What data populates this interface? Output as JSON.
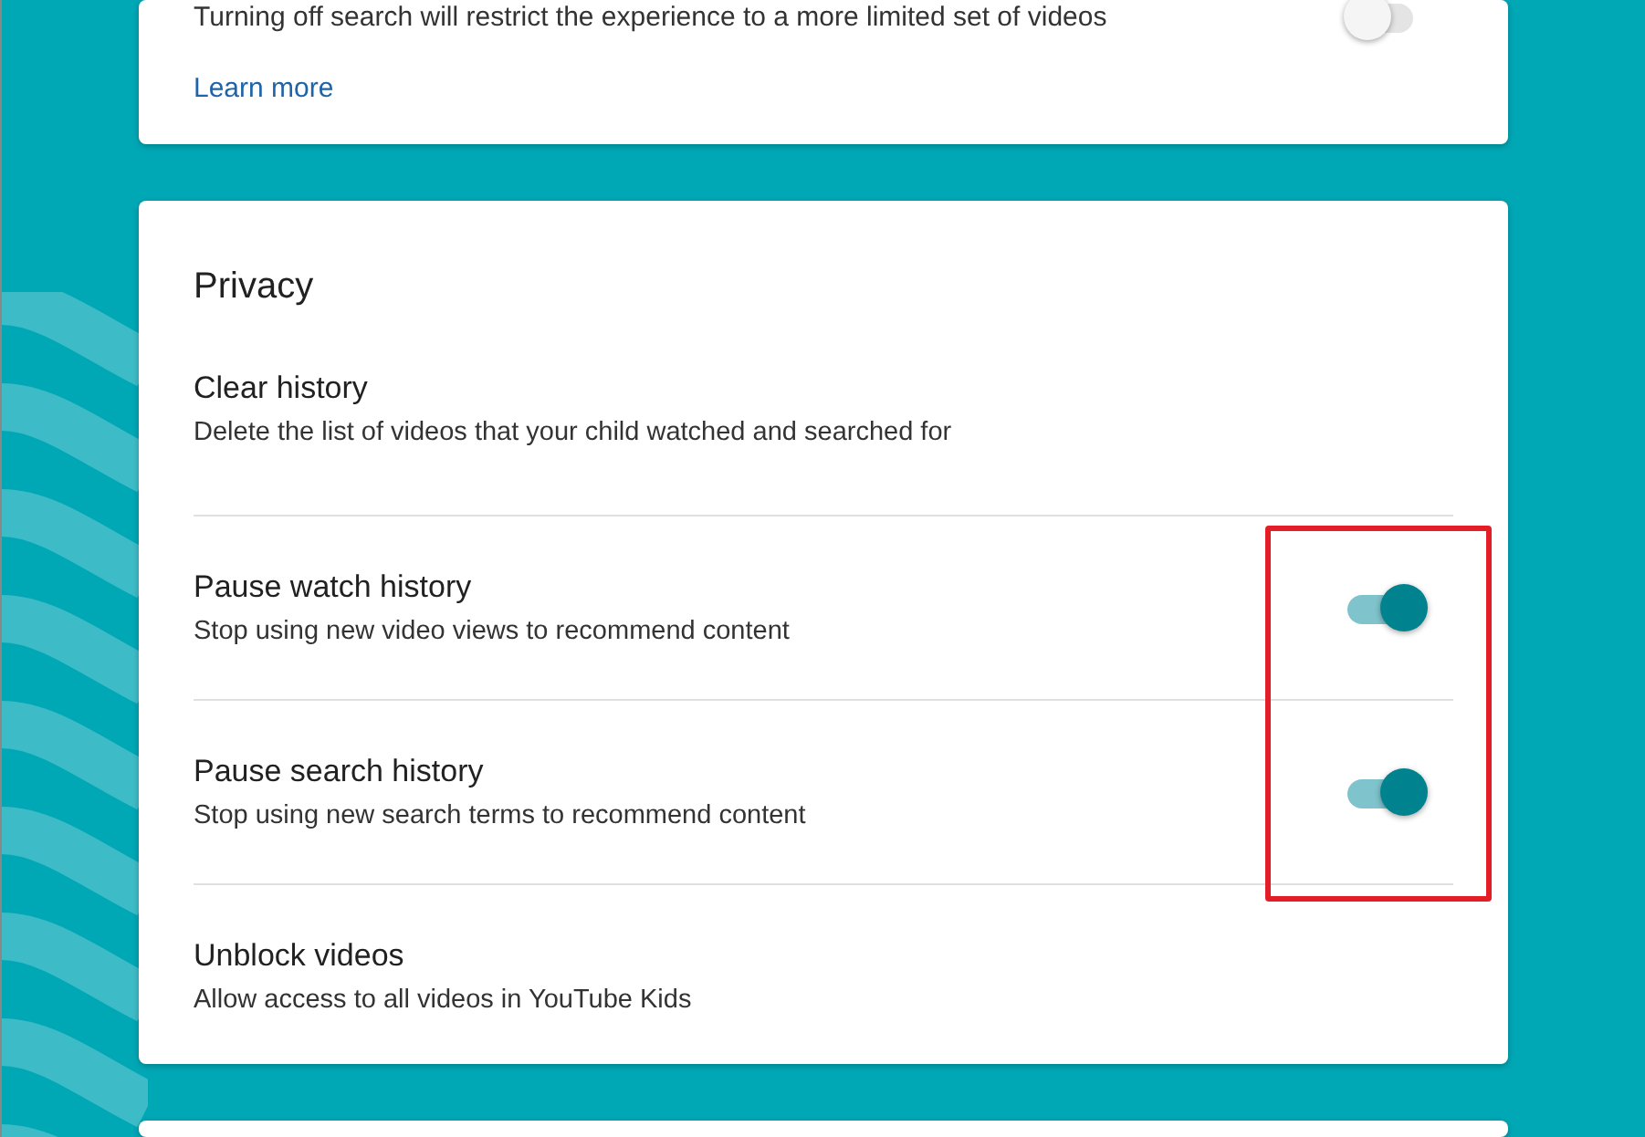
{
  "search_card": {
    "description": "Turning off search will restrict the experience to a more limited set of videos",
    "toggle_on": false,
    "link": "Learn more"
  },
  "privacy": {
    "title": "Privacy",
    "rows": [
      {
        "kind": "action",
        "title": "Clear history",
        "subtitle": "Delete the list of videos that your child watched and searched for",
        "highlighted": false
      },
      {
        "kind": "toggle",
        "title": "Pause watch history",
        "subtitle": "Stop using new video views to recommend content",
        "on": true,
        "highlighted": true
      },
      {
        "kind": "toggle",
        "title": "Pause search history",
        "subtitle": "Stop using new search terms to recommend content",
        "on": true,
        "highlighted": true
      },
      {
        "kind": "action",
        "title": "Unblock videos",
        "subtitle": "Allow access to all videos in YouTube Kids",
        "highlighted": false
      }
    ]
  },
  "annotation": {
    "color": "#e41e26"
  }
}
